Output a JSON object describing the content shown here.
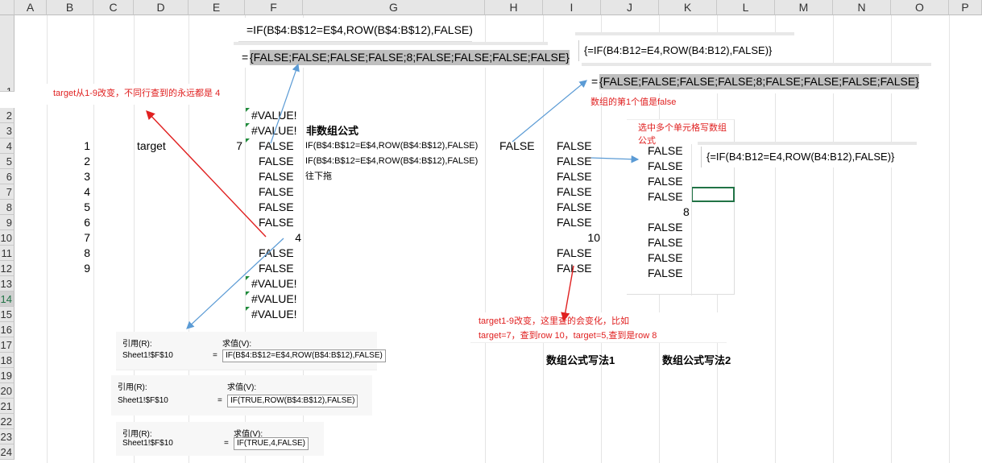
{
  "columns": [
    "A",
    "B",
    "C",
    "D",
    "E",
    "F",
    "G",
    "H",
    "I",
    "J",
    "K",
    "L",
    "M",
    "N",
    "O",
    "P"
  ],
  "rows": [
    "1",
    "2",
    "3",
    "4",
    "5",
    "6",
    "7",
    "8",
    "9",
    "10",
    "11",
    "12",
    "13",
    "14",
    "15",
    "16",
    "17",
    "18",
    "19",
    "20",
    "21",
    "22",
    "23",
    "24"
  ],
  "selected_row": "14",
  "formula_top_1": "=IF(B$4:B$12=E$4,ROW(B$4:B$12),FALSE)",
  "formula_top_2_prefix": "=",
  "formula_top_2": "{FALSE;FALSE;FALSE;FALSE;8;FALSE;FALSE;FALSE;FALSE}",
  "formula_right_1": "{=IF(B4:B12=E4,ROW(B4:B12),FALSE)}",
  "formula_right_2_prefix": "=",
  "formula_right_2": "{FALSE;FALSE;FALSE;FALSE;8;FALSE;FALSE;FALSE;FALSE}",
  "note_first_false": "数组的第1个值是false",
  "note_target": "target从1-9改变，不同行查到的永远都是 4",
  "note_multi_cell": "选中多个单元格写数组公式",
  "formula_multi_cell": "{=IF(B4:B12=E4,ROW(B4:B12),FALSE)}",
  "note_change_1": "target1-9改变，这里查的会变化，比如",
  "note_change_2": "target=7，查到row 10，target=5,查到是row 8",
  "label_array_1": "数组公式写法1",
  "label_array_2": "数组公式写法2",
  "label_non_array": "非数组公式",
  "g_line_1": "IF(B$4:B$12=E$4,ROW(B$4:B$12),FALSE)",
  "g_line_2": "IF(B$4:B$12=E$4,ROW(B$4:B$12),FALSE)",
  "g_line_3": "往下拖",
  "col_b": [
    "1",
    "2",
    "3",
    "4",
    "5",
    "6",
    "7",
    "8",
    "9"
  ],
  "d4": "target",
  "e4": "7",
  "col_f": [
    "#VALUE!",
    "#VALUE!",
    "FALSE",
    "FALSE",
    "FALSE",
    "FALSE",
    "FALSE",
    "FALSE",
    "4",
    "FALSE",
    "FALSE",
    "#VALUE!",
    "#VALUE!",
    "#VALUE!"
  ],
  "h4": "FALSE",
  "col_i": [
    "FALSE",
    "FALSE",
    "FALSE",
    "FALSE",
    "FALSE",
    "FALSE",
    "10",
    "FALSE",
    "FALSE"
  ],
  "col_j_top": [
    "FALSE",
    "FALSE",
    "FALSE",
    "FALSE"
  ],
  "j_eight": "8",
  "col_j_bottom": [
    "FALSE",
    "FALSE",
    "FALSE",
    "FALSE"
  ],
  "eval_1": {
    "ref_label": "引用(R):",
    "ref_value": "Sheet1!$F$10",
    "eq": "=",
    "val_label": "求值(V):",
    "value": "IF(B$4:B$12=E$4,ROW(B$4:B$12),FALSE)"
  },
  "eval_2": {
    "ref_label": "引用(R):",
    "ref_value": "Sheet1!$F$10",
    "eq": "=",
    "val_label": "求值(V):",
    "value": "IF(TRUE,ROW(B$4:B$12),FALSE)"
  },
  "eval_3": {
    "ref_label": "引用(R):",
    "ref_value": "Sheet1!$F$10",
    "eq": "=",
    "val_label": "求值(V):",
    "value": "IF(TRUE,4,FALSE)"
  },
  "colors": {
    "arrow_blue": "#5b9bd5",
    "arrow_red": "#e02020",
    "annotation_red": "#e02020",
    "selection_green": "#217346"
  }
}
